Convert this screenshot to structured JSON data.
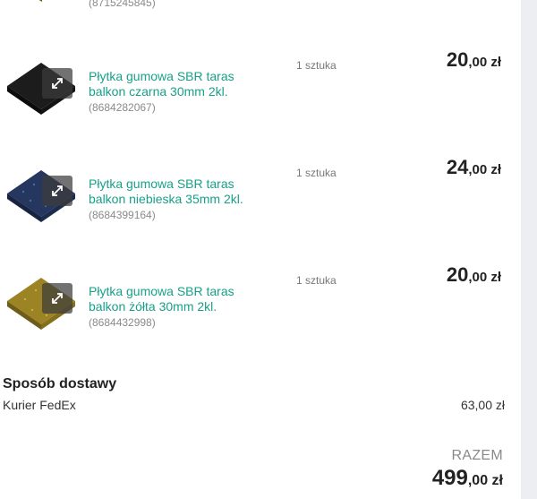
{
  "previous_item": {
    "sku": "(8715245845)"
  },
  "items": [
    {
      "name_line1": "Płytka gumowa SBR taras",
      "name_line2": "balkon czarna 30mm 2kl.",
      "sku": "(8684282067)",
      "quantity": "1 sztuka",
      "price_main": "20",
      "price_fraction": ",00 zł",
      "color": "#1c1c1c"
    },
    {
      "name_line1": "Płytka gumowa SBR taras",
      "name_line2": "balkon niebieska 35mm 2kl.",
      "sku": "(8684399164)",
      "quantity": "1 sztuka",
      "price_main": "24",
      "price_fraction": ",00 zł",
      "color": "#25365f"
    },
    {
      "name_line1": "Płytka gumowa SBR taras",
      "name_line2": "balkon żółta 30mm 2kl.",
      "sku": "(8684432998)",
      "quantity": "1 sztuka",
      "price_main": "20",
      "price_fraction": ",00 zł",
      "color": "#9c8425"
    }
  ],
  "delivery": {
    "title": "Sposób dostawy",
    "method": "Kurier FedEx",
    "price": "63,00 zł"
  },
  "total": {
    "label": "RAZEM",
    "main": "499",
    "fraction": ",00 zł"
  },
  "colors": {
    "link": "#18a08a",
    "muted": "#8a8a8a",
    "scrollbar_track": "#eceef2"
  }
}
